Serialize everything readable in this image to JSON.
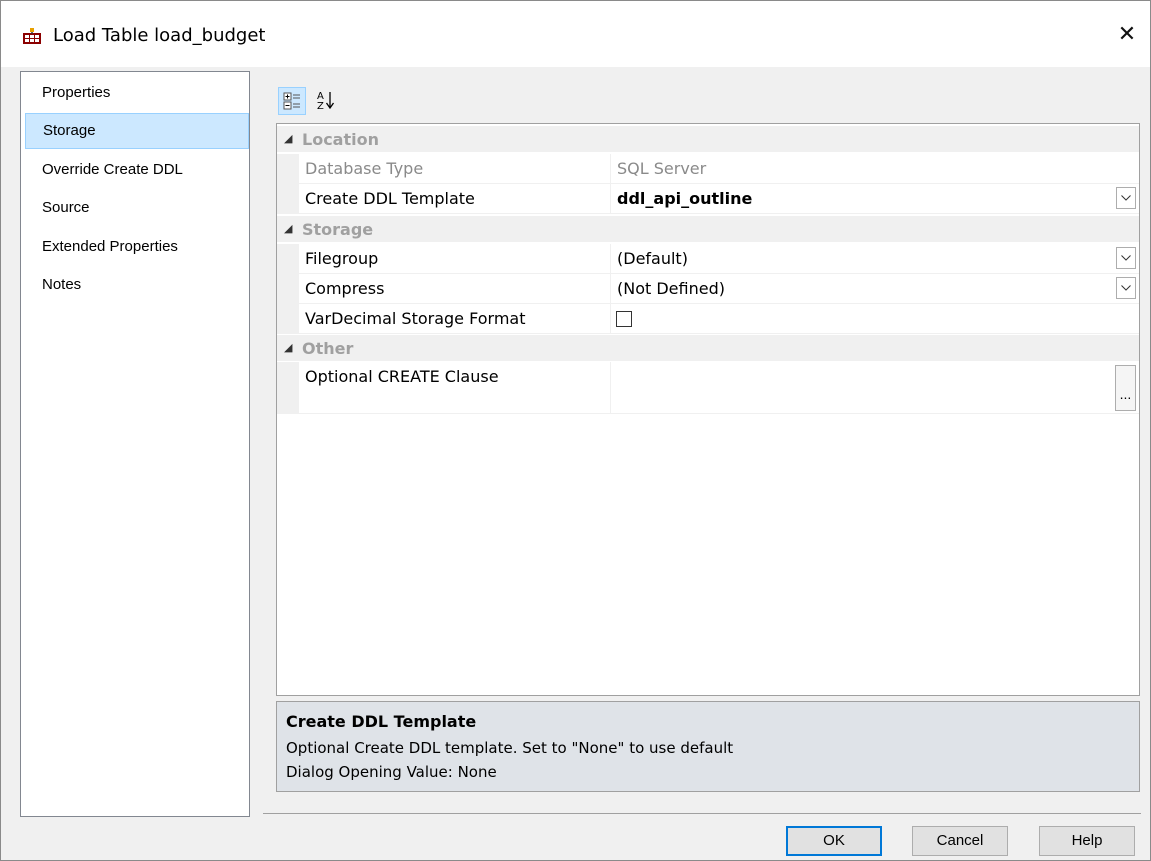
{
  "window": {
    "title": "Load Table load_budget",
    "close_glyph": "✕"
  },
  "nav": {
    "items": [
      {
        "label": "Properties",
        "selected": false
      },
      {
        "label": "Storage",
        "selected": true
      },
      {
        "label": "Override Create DDL",
        "selected": false
      },
      {
        "label": "Source",
        "selected": false
      },
      {
        "label": "Extended Properties",
        "selected": false
      },
      {
        "label": "Notes",
        "selected": false
      }
    ]
  },
  "toolbar": {
    "categorized_icon": "categorized-view-icon",
    "alphabetical_icon": "alphabetical-sort-icon"
  },
  "grid": {
    "categories": [
      {
        "label": "Location",
        "properties": [
          {
            "name": "Database Type",
            "value": "SQL Server",
            "readonly": true
          },
          {
            "name": "Create DDL Template",
            "value": "ddl_api_outline",
            "bold": true,
            "dropdown": true
          }
        ]
      },
      {
        "label": "Storage",
        "properties": [
          {
            "name": "Filegroup",
            "value": "(Default)",
            "dropdown": true
          },
          {
            "name": "Compress",
            "value": "(Not Defined)",
            "dropdown": true
          },
          {
            "name": "VarDecimal Storage Format",
            "value": "",
            "checkbox": true,
            "checked": false
          }
        ]
      },
      {
        "label": "Other",
        "properties": [
          {
            "name": "Optional CREATE Clause",
            "value": "",
            "ellipsis": "..."
          }
        ]
      }
    ]
  },
  "help": {
    "title": "Create DDL Template",
    "description": "Optional Create DDL template. Set to \"None\" to use default",
    "opening_value": "Dialog Opening Value: None"
  },
  "buttons": {
    "ok": "OK",
    "cancel": "Cancel",
    "help": "Help"
  },
  "colors": {
    "selection": "#cce8ff",
    "selection_border": "#99d1ff",
    "default_button_border": "#0078d7",
    "help_pane": "#dfe3e8",
    "category_text": "#a0a0a0"
  }
}
